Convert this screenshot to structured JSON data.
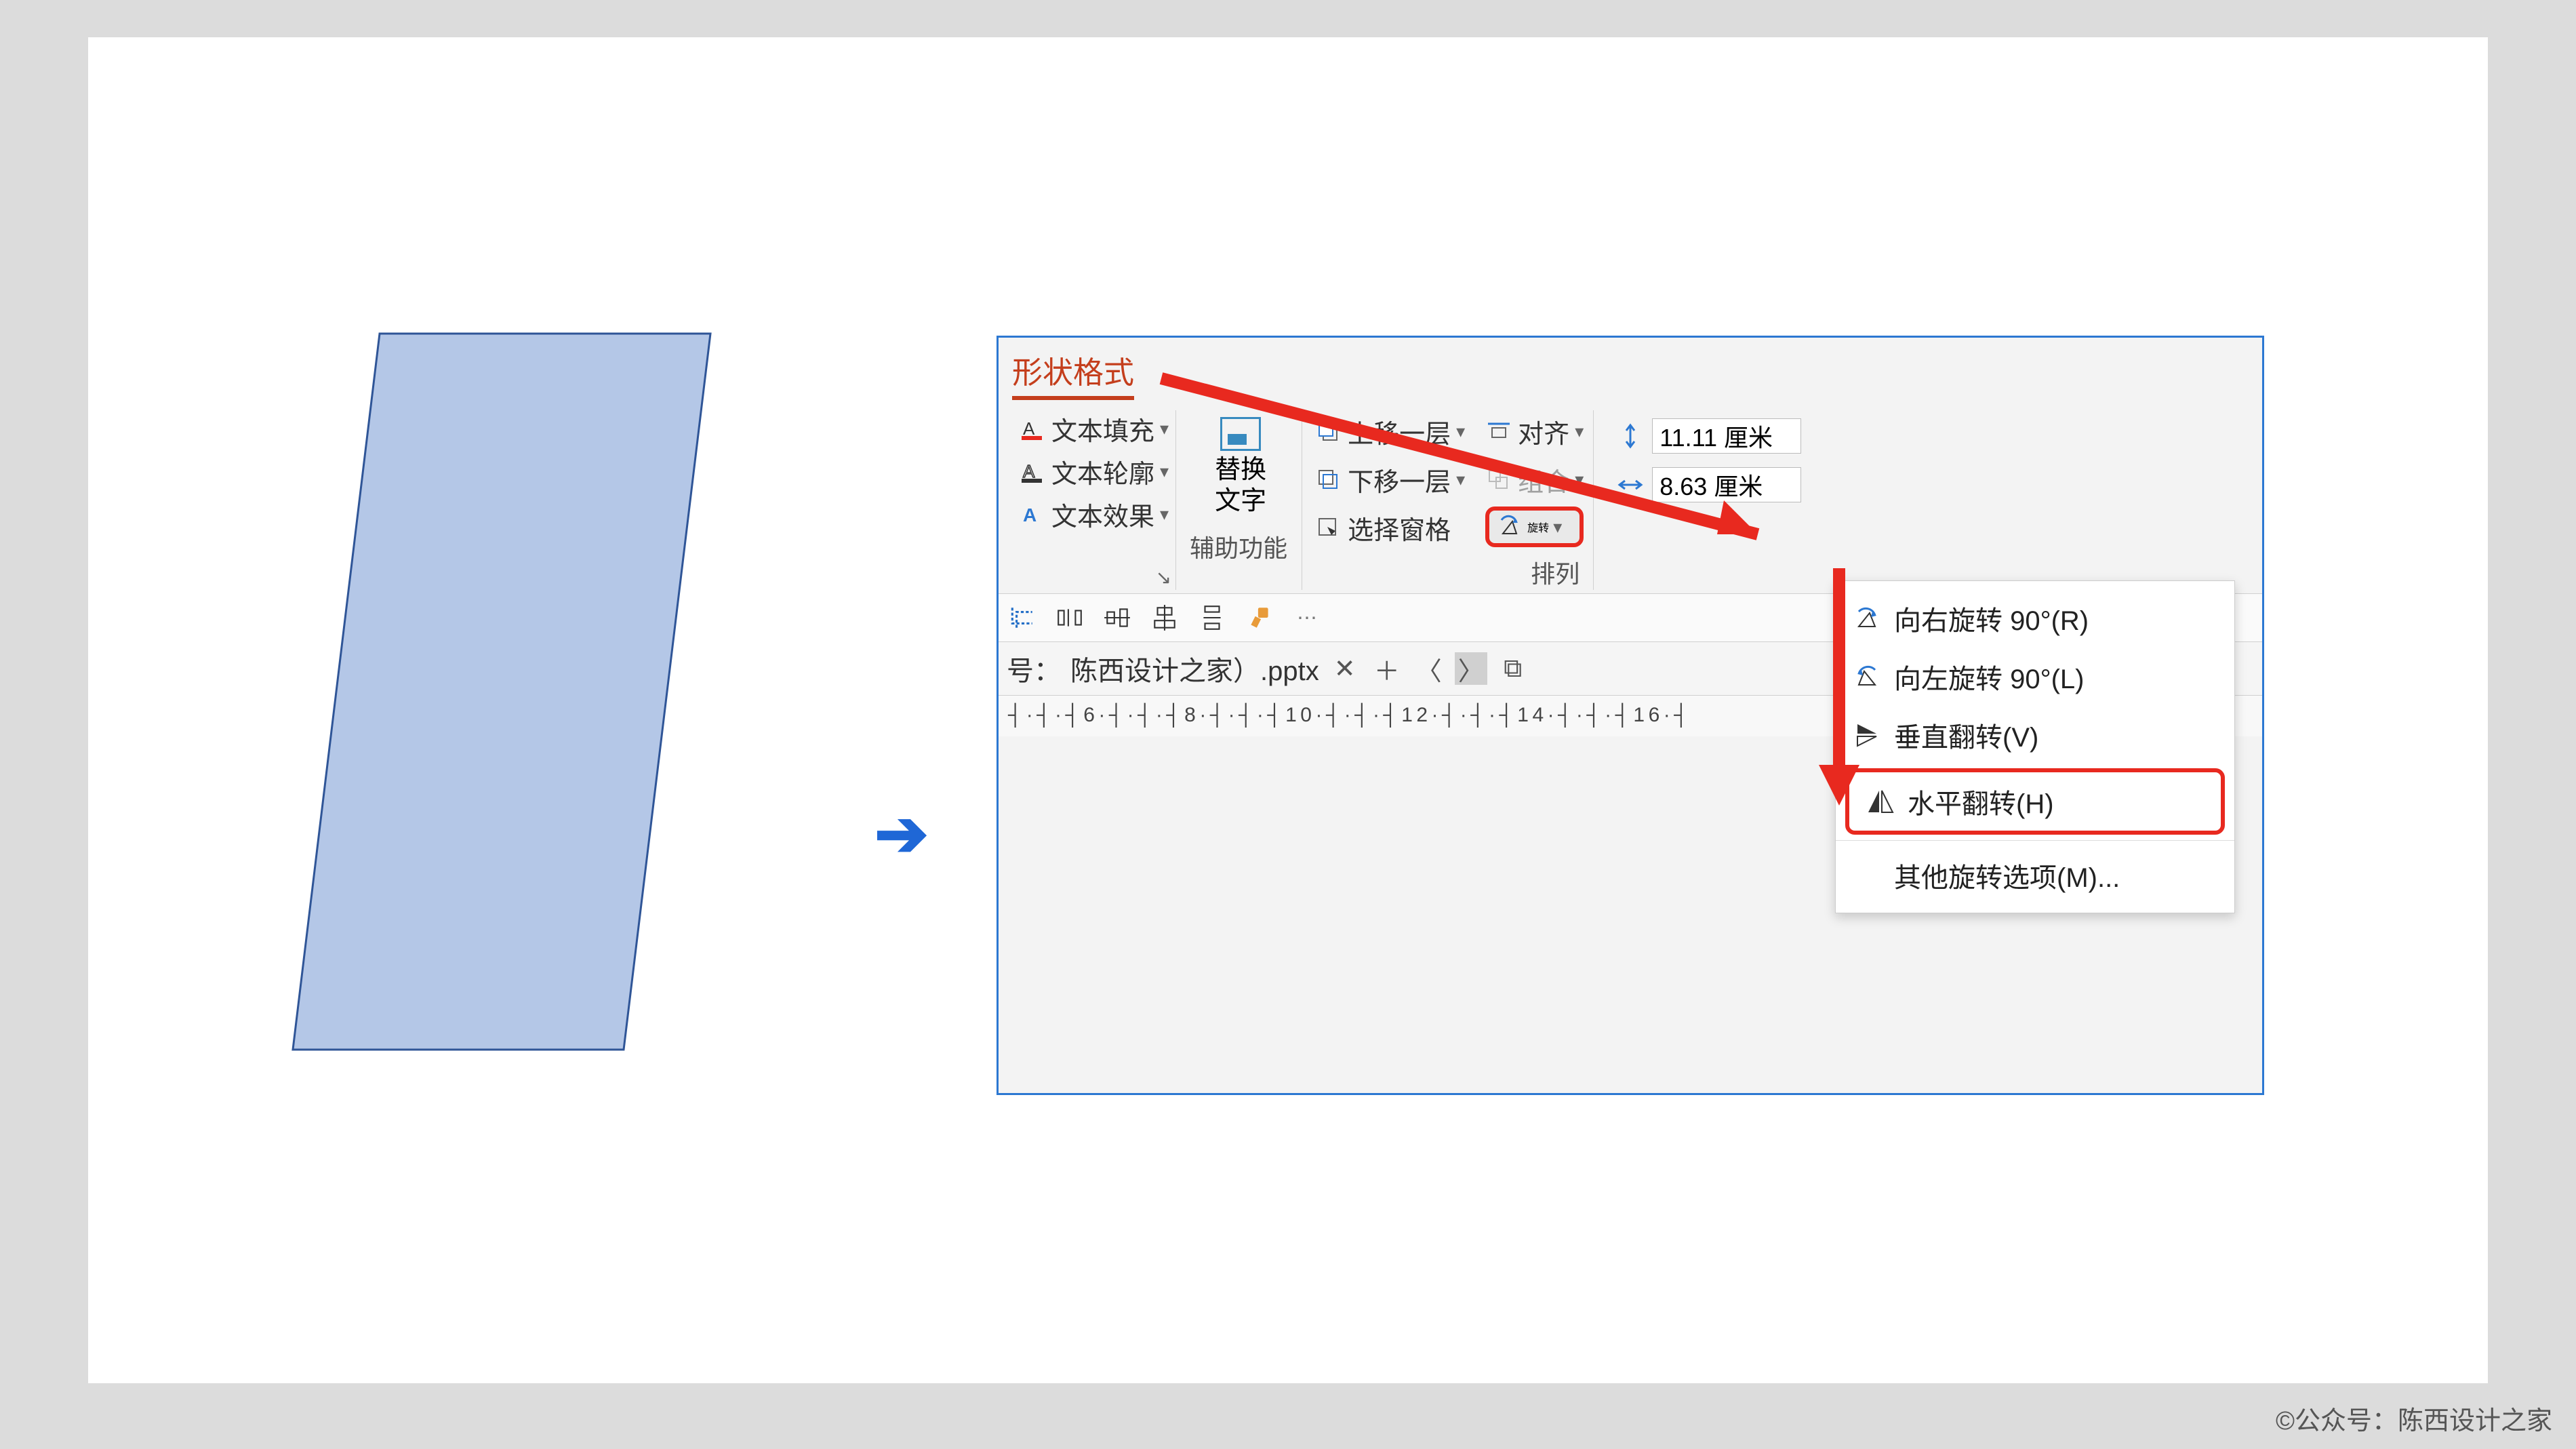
{
  "ribbon_tab": "形状格式",
  "text_group": {
    "fill": "文本填充",
    "outline": "文本轮廓",
    "effects": "文本效果"
  },
  "alt_text": {
    "line1": "替换",
    "line2": "文字",
    "group": "辅助功能"
  },
  "arrange": {
    "bring_forward": "上移一层",
    "send_backward": "下移一层",
    "selection_pane": "选择窗格",
    "align": "对齐",
    "group": "组合",
    "rotate": "旋转",
    "group_label": "排列"
  },
  "size": {
    "height": "11.11 厘米",
    "width": "8.63 厘米"
  },
  "filebar": {
    "label_prefix": "号：",
    "filename": "陈西设计之家）.pptx"
  },
  "ruler": "┤·┤·┤6·┤·┤·┤8·┤·┤·┤10·┤·┤·┤12·┤·┤·┤14·┤·┤·┤16·┤",
  "rotate_menu": {
    "right90": "向右旋转 90°(R)",
    "left90": "向左旋转 90°(L)",
    "flipv": "垂直翻转(V)",
    "fliph": "水平翻转(H)",
    "more": "其他旋转选项(M)..."
  },
  "credit": "©公众号：陈西设计之家"
}
